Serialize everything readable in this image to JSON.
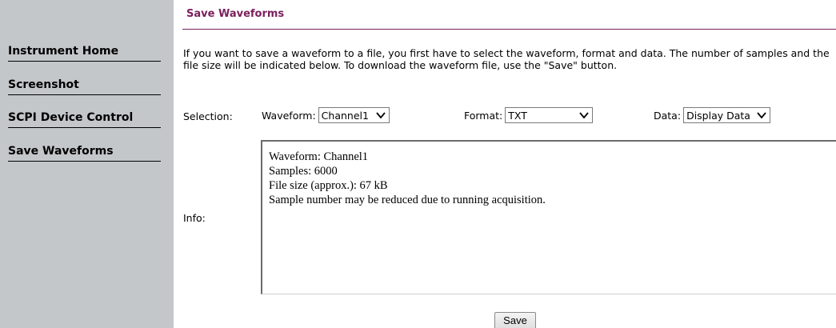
{
  "sidebar": {
    "items": [
      {
        "label": "Instrument Home"
      },
      {
        "label": "Screenshot"
      },
      {
        "label": "SCPI Device Control"
      },
      {
        "label": "Save Waveforms"
      }
    ]
  },
  "page": {
    "title": "Save Waveforms",
    "description": "If you want to save a waveform to a file, you first have to select the waveform, format and data. The number of samples and the file size will be indicated below. To download the waveform file, use the \"Save\" button."
  },
  "selection": {
    "label": "Selection:",
    "waveform": {
      "label": "Waveform:",
      "value": "Channel1"
    },
    "format": {
      "label": "Format:",
      "value": "TXT"
    },
    "data": {
      "label": "Data:",
      "value": "Display Data"
    }
  },
  "info": {
    "label": "Info:",
    "lines": [
      "Waveform: Channel1",
      "Samples: 6000",
      "File size (approx.): 67 kB",
      "Sample number may be reduced due to running acquisition."
    ]
  },
  "actions": {
    "save_label": "Save"
  },
  "colors": {
    "sidebar_bg": "#c4c7ca",
    "accent": "#7a1f5c"
  },
  "icons": {
    "dropdown": "chevron-down-icon"
  }
}
